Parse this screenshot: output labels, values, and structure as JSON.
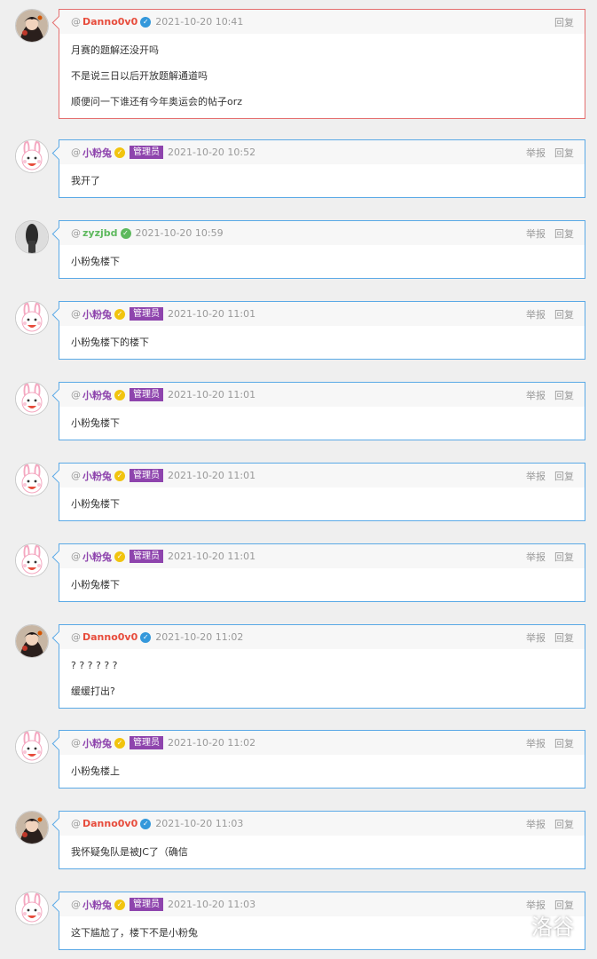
{
  "labels": {
    "at": "@",
    "report": "举报",
    "reply": "回复",
    "admin_tag": "管理员"
  },
  "colors": {
    "red_name": "#e74c3c",
    "purple_name": "#8e44ad",
    "green_name": "#5eb95e",
    "blue_badge": "#3498db",
    "gold_badge": "#f1c40f",
    "green_badge": "#5eb95e",
    "op_border": "#e46f6f",
    "reply_border": "#5aa9e6"
  },
  "posts": [
    {
      "user": "Danno0v0",
      "name_color": "#e74c3c",
      "badge_color": "#3498db",
      "avatar": "anime-avatar",
      "time": "2021-10-20 10:41",
      "admin": false,
      "report": false,
      "op": true,
      "lines": [
        "月赛的题解还没开吗",
        "不是说三日以后开放题解通道吗",
        "顺便问一下谁还有今年奥运会的帖子orz"
      ]
    },
    {
      "user": "小粉兔",
      "name_color": "#8e44ad",
      "badge_color": "#f1c40f",
      "avatar": "bunny-avatar",
      "time": "2021-10-20 10:52",
      "admin": true,
      "report": true,
      "op": false,
      "lines": [
        "我开了"
      ]
    },
    {
      "user": "zyzjbd",
      "name_color": "#5eb95e",
      "badge_color": "#5eb95e",
      "avatar": "dark-avatar",
      "time": "2021-10-20 10:59",
      "admin": false,
      "report": true,
      "op": false,
      "lines": [
        "小粉兔楼下"
      ]
    },
    {
      "user": "小粉兔",
      "name_color": "#8e44ad",
      "badge_color": "#f1c40f",
      "avatar": "bunny-avatar",
      "time": "2021-10-20 11:01",
      "admin": true,
      "report": true,
      "op": false,
      "lines": [
        "小粉兔楼下的楼下"
      ]
    },
    {
      "user": "小粉兔",
      "name_color": "#8e44ad",
      "badge_color": "#f1c40f",
      "avatar": "bunny-avatar",
      "time": "2021-10-20 11:01",
      "admin": true,
      "report": true,
      "op": false,
      "lines": [
        "小粉兔楼下"
      ]
    },
    {
      "user": "小粉兔",
      "name_color": "#8e44ad",
      "badge_color": "#f1c40f",
      "avatar": "bunny-avatar",
      "time": "2021-10-20 11:01",
      "admin": true,
      "report": true,
      "op": false,
      "lines": [
        "小粉兔楼下"
      ]
    },
    {
      "user": "小粉兔",
      "name_color": "#8e44ad",
      "badge_color": "#f1c40f",
      "avatar": "bunny-avatar",
      "time": "2021-10-20 11:01",
      "admin": true,
      "report": true,
      "op": false,
      "lines": [
        "小粉兔楼下"
      ]
    },
    {
      "user": "Danno0v0",
      "name_color": "#e74c3c",
      "badge_color": "#3498db",
      "avatar": "anime-avatar",
      "time": "2021-10-20 11:02",
      "admin": false,
      "report": true,
      "op": false,
      "lines": [
        "? ? ? ? ? ?",
        "缓缓打出?"
      ]
    },
    {
      "user": "小粉兔",
      "name_color": "#8e44ad",
      "badge_color": "#f1c40f",
      "avatar": "bunny-avatar",
      "time": "2021-10-20 11:02",
      "admin": true,
      "report": true,
      "op": false,
      "lines": [
        "小粉兔楼上"
      ]
    },
    {
      "user": "Danno0v0",
      "name_color": "#e74c3c",
      "badge_color": "#3498db",
      "avatar": "anime-avatar",
      "time": "2021-10-20 11:03",
      "admin": false,
      "report": true,
      "op": false,
      "lines": [
        "我怀疑兔队是被JC了（确信"
      ]
    },
    {
      "user": "小粉兔",
      "name_color": "#8e44ad",
      "badge_color": "#f1c40f",
      "avatar": "bunny-avatar",
      "time": "2021-10-20 11:03",
      "admin": true,
      "report": true,
      "op": false,
      "lines": [
        "这下尴尬了，楼下不是小粉兔"
      ]
    }
  ],
  "watermark": "洛谷"
}
